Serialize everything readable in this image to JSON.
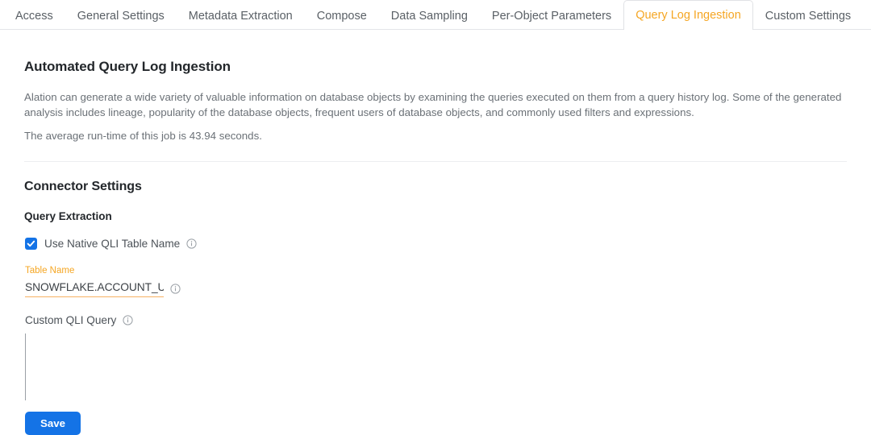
{
  "tabs": [
    {
      "label": "Access",
      "active": false
    },
    {
      "label": "General Settings",
      "active": false
    },
    {
      "label": "Metadata Extraction",
      "active": false
    },
    {
      "label": "Compose",
      "active": false
    },
    {
      "label": "Data Sampling",
      "active": false
    },
    {
      "label": "Per-Object Parameters",
      "active": false
    },
    {
      "label": "Query Log Ingestion",
      "active": true
    },
    {
      "label": "Custom Settings",
      "active": false
    }
  ],
  "main": {
    "page_title": "Automated Query Log Ingestion",
    "intro_text": "Alation can generate a wide variety of valuable information on database objects by examining the queries executed on them from a query history log. Some of the generated analysis includes lineage, popularity of the database objects, frequent users of database objects, and commonly used filters and expressions.",
    "runtime_text": "The average run-time of this job is 43.94 seconds.",
    "section_title": "Connector Settings",
    "subsection_title": "Query Extraction",
    "native_qli": {
      "label": "Use Native QLI Table Name",
      "checked": true,
      "info_icon": "info-circle-icon"
    },
    "table_name": {
      "label": "Table Name",
      "value": "SNOWFLAKE.ACCOUNT_USAGE.QUERY_HISTORY",
      "placeholder": "Table Name",
      "info_icon": "info-circle-icon"
    },
    "custom_qli_query": {
      "label": "Custom QLI Query",
      "value": "",
      "placeholder": "",
      "info_icon": "info-circle-icon"
    },
    "save_label": "Save"
  },
  "colors": {
    "accent_orange": "#F5A623",
    "accent_blue": "#1473E6",
    "text_primary": "#23272B",
    "text_secondary": "#6B7177",
    "border": "#E3E5E8"
  }
}
